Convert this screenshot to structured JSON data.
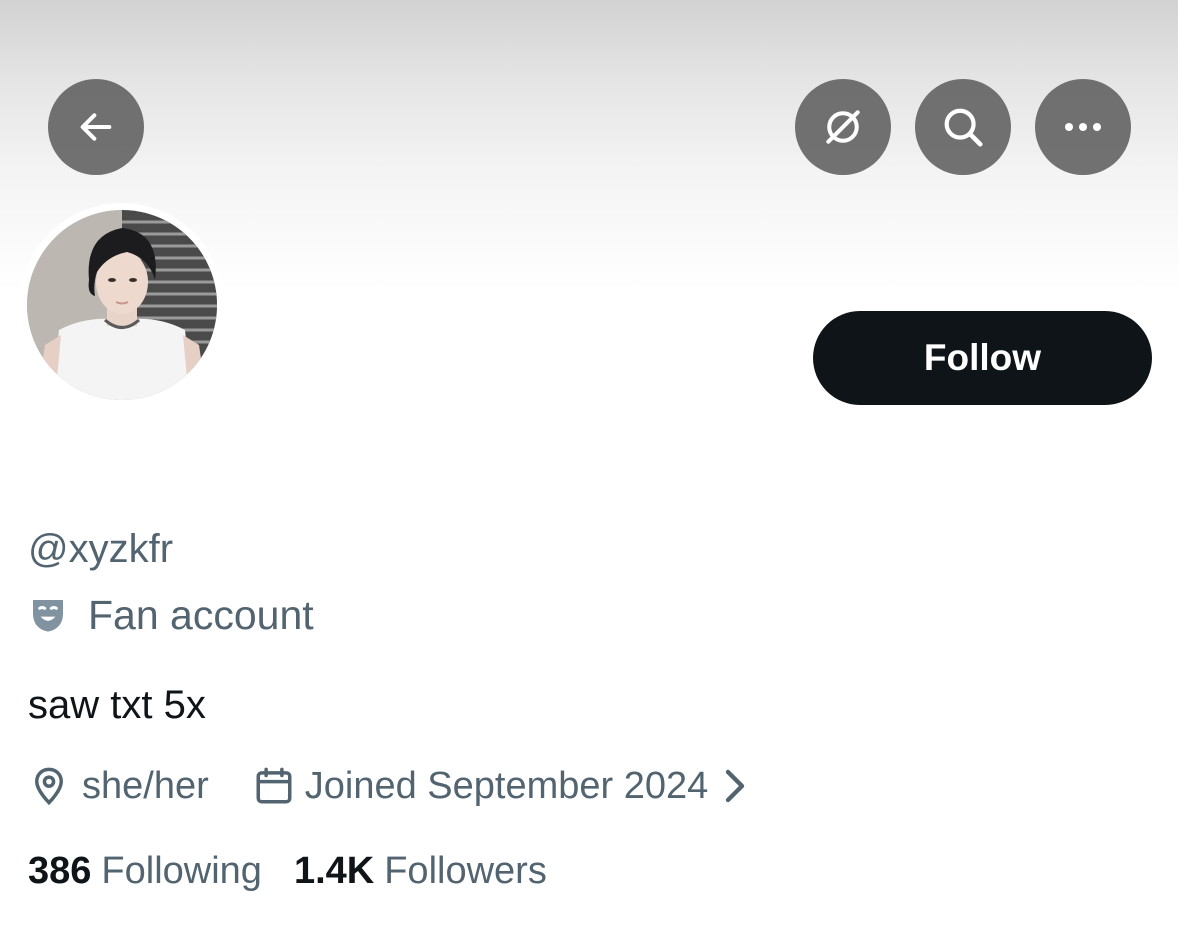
{
  "header": {
    "back_icon": "arrow-left-icon",
    "grok_icon": "grok-icon",
    "search_icon": "search-icon",
    "more_icon": "more-horizontal-icon"
  },
  "profile": {
    "follow_label": "Follow",
    "handle": "@xyzkfr",
    "category_icon": "theater-mask-icon",
    "category": "Fan account",
    "bio": "saw txt 5x",
    "location_icon": "location-pin-icon",
    "location": "she/her",
    "joined_icon": "calendar-icon",
    "joined": "Joined September 2024",
    "following_count": "386",
    "following_label": "Following",
    "followers_count": "1.4K",
    "followers_label": "Followers"
  },
  "colors": {
    "primary_text": "#0f1419",
    "secondary_text": "#536471",
    "button_dark": "#0f1419"
  }
}
